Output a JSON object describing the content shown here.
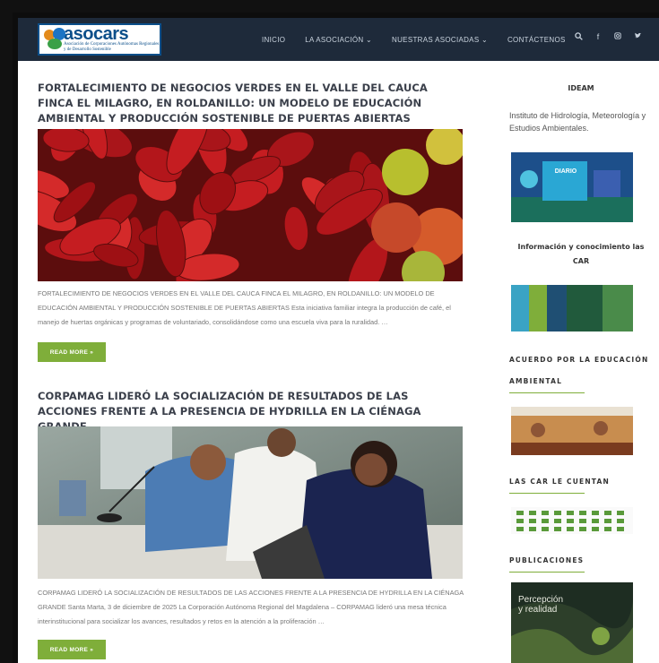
{
  "header": {
    "logo_name": "asocars",
    "logo_tagline": "Asociación de Corporaciones Autónomas Regionales y de Desarrollo Sostenible",
    "nav": [
      "INICIO",
      "LA ASOCIACIÓN ⌄",
      "NUESTRAS ASOCIADAS ⌄",
      "CONTÁCTENOS"
    ],
    "icons": [
      "search-icon",
      "facebook-icon",
      "instagram-icon",
      "twitter-icon"
    ]
  },
  "posts": [
    {
      "title": "FORTALECIMIENTO DE NEGOCIOS VERDES EN EL VALLE DEL CAUCA FINCA EL MILAGRO, EN ROLDANILLO: UN MODELO DE EDUCACIÓN AMBIENTAL Y PRODUCCIÓN SOSTENIBLE DE PUERTAS ABIERTAS",
      "excerpt": "FORTALECIMIENTO DE NEGOCIOS VERDES EN EL VALLE DEL CAUCA FINCA EL MILAGRO, EN ROLDANILLO: UN MODELO DE EDUCACIÓN AMBIENTAL Y PRODUCCIÓN SOSTENIBLE DE PUERTAS ABIERTAS Esta iniciativa familiar integra la producción de café, el manejo de huertas orgánicas y programas de voluntariado, consolidándose como una escuela viva para la ruralidad. …",
      "read_more": "READ MORE »"
    },
    {
      "title": "CORPAMAG LIDERÓ LA SOCIALIZACIÓN DE RESULTADOS DE LAS ACCIONES FRENTE A LA PRESENCIA DE HYDRILLA  EN LA CIÉNAGA GRANDE",
      "excerpt": "CORPAMAG LIDERÓ LA SOCIALIZACIÓN DE RESULTADOS DE LAS ACCIONES FRENTE A LA PRESENCIA DE HYDRILLA  EN LA CIÉNAGA GRANDE Santa Marta, 3 de diciembre de 2025 La Corporación Autónoma Regional del Magdalena – CORPAMAG lideró una mesa técnica interinstitucional para socializar los avances, resultados y retos en la atención a la proliferación …",
      "read_more": "READ MORE »"
    }
  ],
  "sidebar": {
    "ideam_title": "IDEAM",
    "ideam_text": "Instituto de Hidrología, Meteorología y Estudios Ambientales.",
    "ideam_banner": "DIARIO",
    "info_title": "Información y conocimiento las CAR",
    "acuerdo_title": "ACUERDO POR LA EDUCACIÓN AMBIENTAL",
    "cuentan_title": "LAS CAR LE CUENTAN",
    "publicaciones_title": "PUBLICACIONES",
    "publicacion_cover": [
      "Percepción",
      "y realidad"
    ]
  },
  "colors": {
    "header_bg": "#1e2a3a",
    "accent_green": "#7fae3a",
    "brand_blue": "#0b4f8a"
  }
}
